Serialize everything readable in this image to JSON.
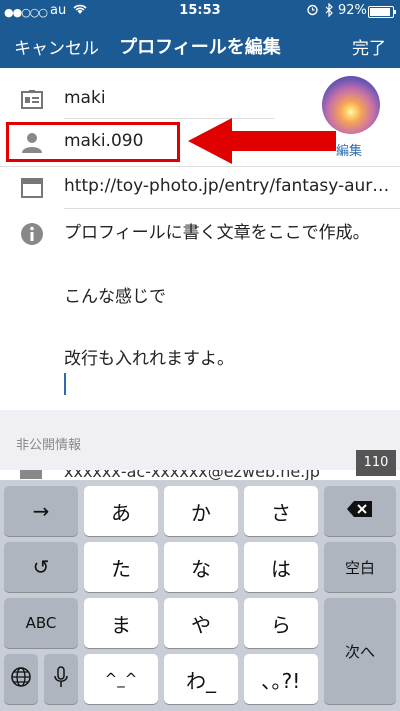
{
  "status": {
    "signal": "●●○○○",
    "carrier": "au",
    "time": "15:53",
    "battery": "92%"
  },
  "nav": {
    "cancel": "キャンセル",
    "title": "プロフィールを編集",
    "done": "完了"
  },
  "profile": {
    "name": "maki",
    "username": "maki.090",
    "website": "http://toy-photo.jp/entry/fantasy-aur…",
    "avatar_edit": "編集",
    "bio": [
      "プロフィールに書く文章をここで作成。",
      "こんな感じで",
      "",
      "改行も入れれますよ。"
    ]
  },
  "private": {
    "header": "非公開情報",
    "email": "xxxxxx-ac-xxxxxx@ezweb.ne.jp",
    "char_count": "110"
  },
  "keyboard": {
    "row1": [
      "→",
      "あ",
      "か",
      "さ",
      "⌫"
    ],
    "row2": [
      "↺",
      "た",
      "な",
      "は",
      "空白"
    ],
    "row3": [
      "ABC",
      "ま",
      "や",
      "ら",
      "次へ"
    ],
    "row4": [
      "🌐",
      "🎤",
      "^_^",
      "わ_",
      "､｡?!"
    ]
  },
  "colors": {
    "nav_bg": "#1c5a93",
    "highlight": "#e00000",
    "link": "#2a6bb3"
  }
}
